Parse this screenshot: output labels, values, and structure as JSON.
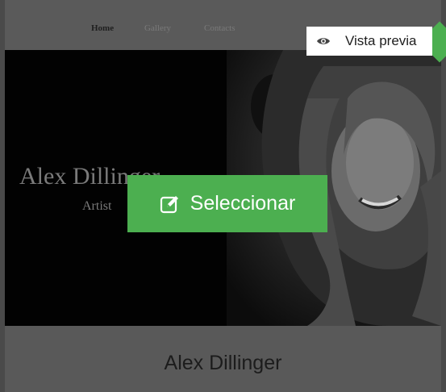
{
  "site_nav": {
    "links": [
      {
        "label": "Home",
        "active": true
      },
      {
        "label": "Gallery",
        "active": false
      },
      {
        "label": "Contacts",
        "active": false
      }
    ]
  },
  "hero": {
    "name": "Alex Dillinger",
    "role": "Artist"
  },
  "footer": {
    "name": "Alex Dillinger"
  },
  "actions": {
    "select_label": "Seleccionar",
    "select_icon": "edit-icon",
    "preview_label": "Vista previa",
    "preview_icon": "eye-icon"
  },
  "colors": {
    "accent": "#4caf50",
    "overlay": "#575757"
  }
}
